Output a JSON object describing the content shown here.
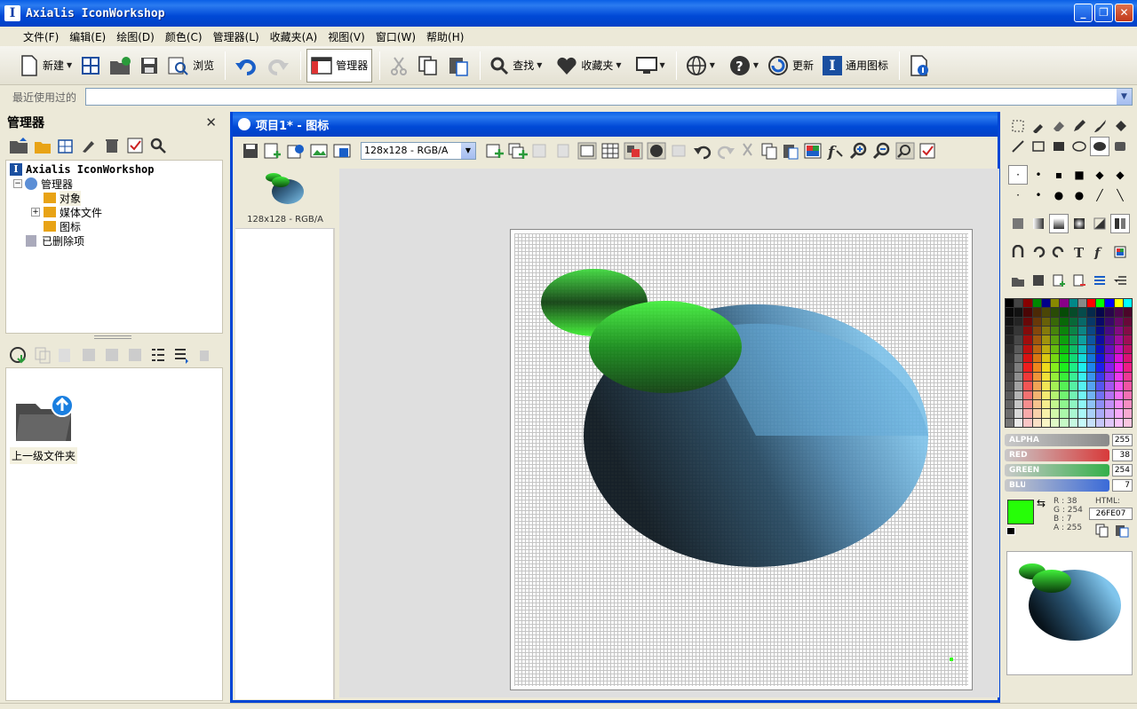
{
  "window": {
    "title": "Axialis IconWorkshop",
    "app_icon": "I",
    "buttons": {
      "minimize": "_",
      "maximize": "❐",
      "close": "✕"
    }
  },
  "menu": [
    "文件(F)",
    "编辑(E)",
    "绘图(D)",
    "颜色(C)",
    "管理器(L)",
    "收藏夹(A)",
    "视图(V)",
    "窗口(W)",
    "帮助(H)"
  ],
  "toolbar": {
    "new": "新建",
    "browse": "浏览",
    "manager": "管理器",
    "find": "查找",
    "favorites": "收藏夹",
    "update": "更新",
    "generic_icons": "通用图标"
  },
  "recent": {
    "label": "最近使用过的",
    "value": ""
  },
  "manager_panel": {
    "title": "管理器",
    "close": "✕",
    "tree": [
      {
        "label": "Axialis IconWorkshop",
        "level": 0
      },
      {
        "label": "管理器",
        "level": 1
      },
      {
        "label": "对象",
        "level": 2
      },
      {
        "label": "媒体文件",
        "level": 2
      },
      {
        "label": "图标",
        "level": 2
      },
      {
        "label": "已删除项",
        "level": 1
      }
    ],
    "up_folder": "上一级文件夹"
  },
  "document": {
    "title": "项目1* - 图标",
    "format_select": "128x128 - RGB/A",
    "thumb_label": "128x128 - RGB/A"
  },
  "color_panel": {
    "sliders": [
      {
        "name": "ALPHA",
        "value": "255",
        "color": "#8a8a8a"
      },
      {
        "name": "RED",
        "value": "38",
        "color": "#d83a3a"
      },
      {
        "name": "GREEN",
        "value": "254",
        "color": "#34b04a"
      },
      {
        "name": "BLUE",
        "value": "7",
        "color": "#3a6ad8"
      }
    ],
    "current_color": "#26FE07",
    "rgba": [
      "R : 38",
      "G : 254",
      "B : 7",
      "A : 255"
    ],
    "html_label": "HTML:",
    "html_value": "26FE07"
  }
}
